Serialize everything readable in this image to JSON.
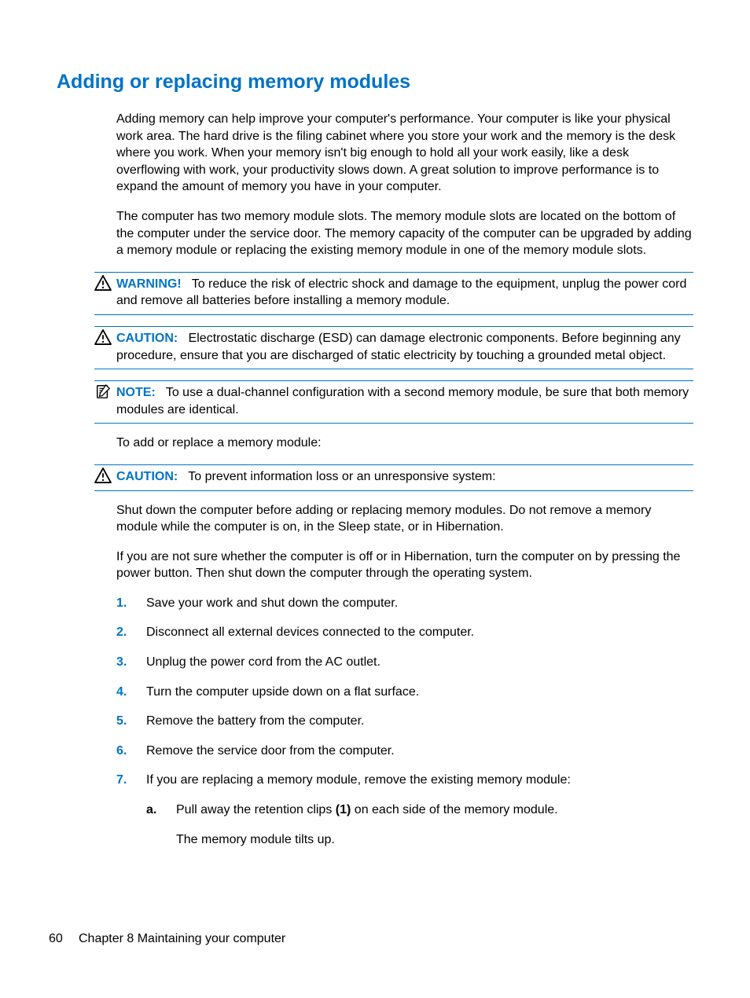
{
  "title": "Adding or replacing memory modules",
  "paragraphs": {
    "p1": "Adding memory can help improve your computer's performance. Your computer is like your physical work area. The hard drive is the filing cabinet where you store your work and the memory is the desk where you work. When your memory isn't big enough to hold all your work easily, like a desk overflowing with work, your productivity slows down. A great solution to improve performance is to expand the amount of memory you have in your computer.",
    "p2": "The computer has two memory module slots. The memory module slots are located on the bottom of the computer under the service door. The memory capacity of the computer can be upgraded by adding a memory module or replacing the existing memory module in one of the memory module slots.",
    "p3": "To add or replace a memory module:",
    "p4": "Shut down the computer before adding or replacing memory modules. Do not remove a memory module while the computer is on, in the Sleep state, or in Hibernation.",
    "p5": "If you are not sure whether the computer is off or in Hibernation, turn the computer on by pressing the power button. Then shut down the computer through the operating system."
  },
  "callouts": {
    "warning": {
      "label": "WARNING!",
      "text": "To reduce the risk of electric shock and damage to the equipment, unplug the power cord and remove all batteries before installing a memory module."
    },
    "caution1": {
      "label": "CAUTION:",
      "text": "Electrostatic discharge (ESD) can damage electronic components. Before beginning any procedure, ensure that you are discharged of static electricity by touching a grounded metal object."
    },
    "note": {
      "label": "NOTE:",
      "text": "To use a dual-channel configuration with a second memory module, be sure that both memory modules are identical."
    },
    "caution2": {
      "label": "CAUTION:",
      "text": "To prevent information loss or an unresponsive system:"
    }
  },
  "steps": [
    {
      "n": "1.",
      "t": "Save your work and shut down the computer."
    },
    {
      "n": "2.",
      "t": "Disconnect all external devices connected to the computer."
    },
    {
      "n": "3.",
      "t": "Unplug the power cord from the AC outlet."
    },
    {
      "n": "4.",
      "t": "Turn the computer upside down on a flat surface."
    },
    {
      "n": "5.",
      "t": "Remove the battery from the computer."
    },
    {
      "n": "6.",
      "t": "Remove the service door from the computer."
    },
    {
      "n": "7.",
      "t": "If you are replacing a memory module, remove the existing memory module:"
    }
  ],
  "substep": {
    "sn": "a.",
    "prefix": "Pull away the retention clips ",
    "bold": "(1)",
    "suffix": " on each side of the memory module.",
    "after": "The memory module tilts up."
  },
  "footer": {
    "page": "60",
    "chapter": "Chapter 8   Maintaining your computer"
  }
}
